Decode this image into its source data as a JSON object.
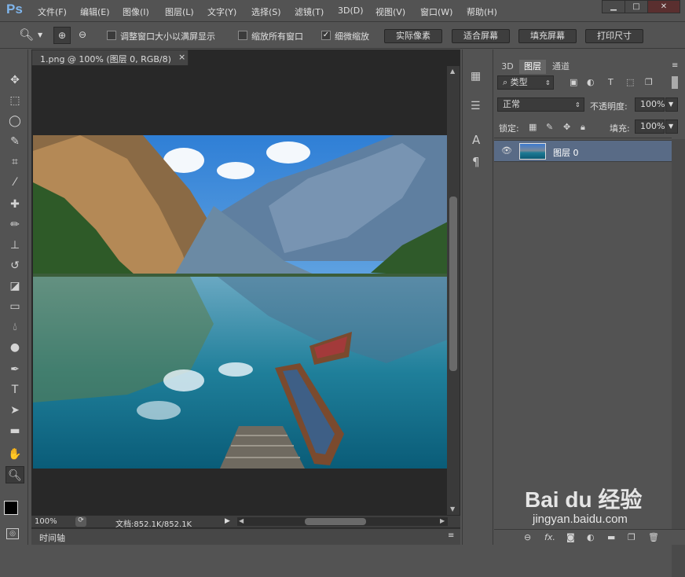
{
  "app": {
    "logo": "Ps"
  },
  "menu": [
    "文件(F)",
    "编辑(E)",
    "图像(I)",
    "图层(L)",
    "文字(Y)",
    "选择(S)",
    "滤镜(T)",
    "3D(D)",
    "视图(V)",
    "窗口(W)",
    "帮助(H)"
  ],
  "window_controls": {
    "minimize": "▁",
    "maximize": "□",
    "close": "✕"
  },
  "options": {
    "resize_windows": {
      "label": "调整窗口大小以满屏显示",
      "checked": false
    },
    "zoom_all": {
      "label": "缩放所有窗口",
      "checked": false
    },
    "scrubby": {
      "label": "细微缩放",
      "checked": true,
      "mark": "✓"
    },
    "buttons": [
      "实际像素",
      "适合屏幕",
      "填充屏幕",
      "打印尺寸"
    ]
  },
  "document": {
    "tab_title": "1.png @ 100% (图层 0, RGB/8)",
    "tab_close": "×",
    "zoom": "100%",
    "doc_info": "文档:852.1K/852.1K"
  },
  "timeline": {
    "label": "时间轴"
  },
  "panel": {
    "tabs": [
      "3D",
      "图层",
      "通道"
    ],
    "active_tab": "图层",
    "filter": "类型",
    "blend_mode": "正常",
    "opacity_label": "不透明度:",
    "opacity_value": "100%",
    "lock_label": "锁定:",
    "fill_label": "填充:",
    "fill_value": "100%",
    "layers": [
      {
        "name": "图层 0",
        "visible": true
      }
    ]
  },
  "watermark": {
    "brand": "Bai du 经验",
    "url": "jingyan.baidu.com"
  },
  "colors": {
    "accent": "#7fb5ec",
    "selected_layer": "#596b86",
    "bg": "#535353",
    "canvas": "#282828"
  }
}
